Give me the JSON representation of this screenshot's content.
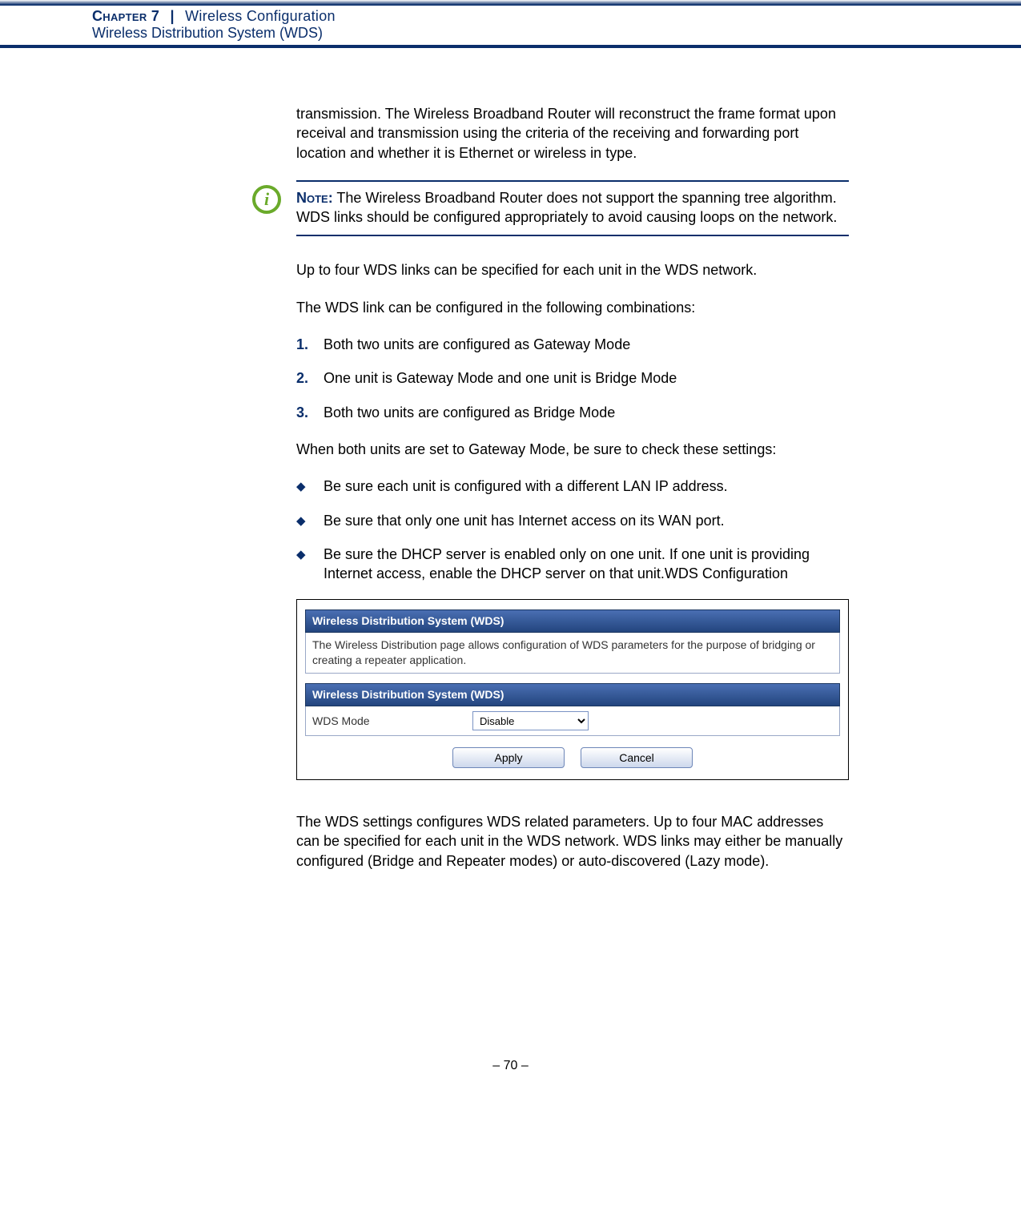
{
  "header": {
    "chapter_prefix": "Chapter 7",
    "pipe": "|",
    "chapter_name": "Wireless Configuration",
    "section": "Wireless Distribution System (WDS)"
  },
  "para_transmission": "transmission. The Wireless Broadband Router will reconstruct the frame format upon receival and transmission using the criteria of the receiving and forwarding port location and whether it is Ethernet or wireless in type.",
  "note": {
    "label": "Note:",
    "text": " The Wireless Broadband Router does not support the spanning tree algorithm. WDS links should be configured appropriately to avoid causing loops on the network.",
    "icon_glyph": "i"
  },
  "para_uptofour": "Up to four WDS links can be specified for each unit in the WDS network.",
  "para_combos": "The WDS link can be configured in the following combinations:",
  "numlist": [
    {
      "n": "1.",
      "t": "Both two units are configured as Gateway Mode"
    },
    {
      "n": "2.",
      "t": "One unit is Gateway Mode and one unit is Bridge Mode"
    },
    {
      "n": "3.",
      "t": "Both two units are configured as Bridge Mode"
    }
  ],
  "para_gateway_check": "When both units are set to Gateway Mode, be sure to check these settings:",
  "dlist": [
    "Be sure each unit is configured with a different LAN IP address.",
    "Be sure that only one unit has Internet access on its WAN port.",
    "Be sure the DHCP server is enabled only on one unit. If one unit is providing Internet access, enable the DHCP server on that unit.WDS Configuration"
  ],
  "bullet_glyph": "◆",
  "ui": {
    "panel1_title": "Wireless Distribution System (WDS)",
    "panel1_body": "The Wireless Distribution page allows configuration of WDS parameters for the purpose of bridging or creating a repeater application.",
    "panel2_title": "Wireless Distribution System (WDS)",
    "mode_label": "WDS Mode",
    "mode_value": "Disable",
    "apply": "Apply",
    "cancel": "Cancel"
  },
  "para_after_ui": "The WDS settings configures WDS related parameters. Up to four MAC addresses can be specified for each unit in the WDS network. WDS links may either be manually configured (Bridge and Repeater modes) or auto-discovered (Lazy mode).",
  "footer": "–  70  –"
}
